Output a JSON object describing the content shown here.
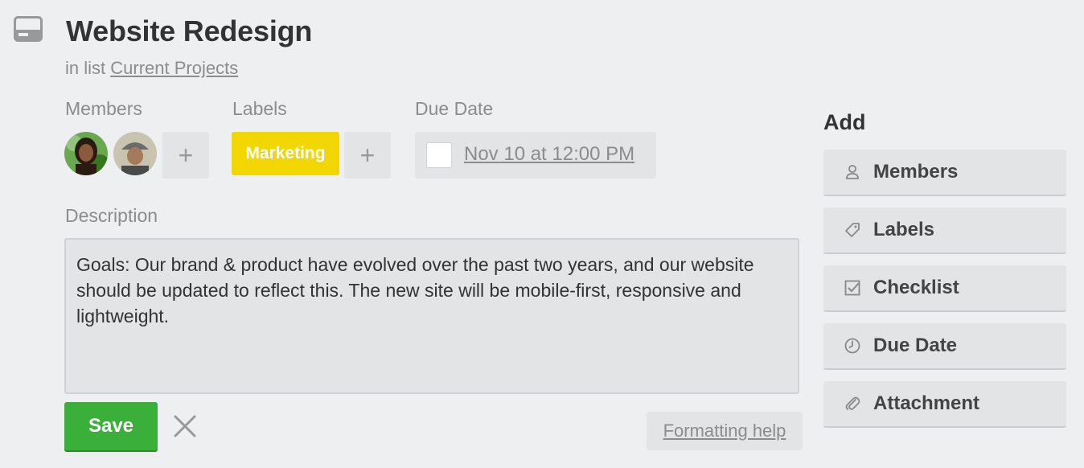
{
  "card": {
    "title": "Website Redesign",
    "list_prefix": "in list",
    "list_name": "Current Projects"
  },
  "members": {
    "heading": "Members",
    "add_symbol": "+"
  },
  "labels": {
    "heading": "Labels",
    "items": [
      {
        "text": "Marketing",
        "color": "#f2d600"
      }
    ],
    "add_symbol": "+"
  },
  "due": {
    "heading": "Due Date",
    "value": "Nov 10 at 12:00 PM"
  },
  "description": {
    "heading": "Description",
    "text": "Goals: Our brand & product have evolved over the past two years, and our website should be updated to reflect this. The new site will be mobile-first, responsive and lightweight.",
    "save_label": "Save",
    "formatting_help": "Formatting help"
  },
  "sidebar": {
    "heading": "Add",
    "buttons": [
      {
        "label": "Members",
        "icon": "person-icon"
      },
      {
        "label": "Labels",
        "icon": "tag-icon"
      },
      {
        "label": "Checklist",
        "icon": "checkbox-icon"
      },
      {
        "label": "Due Date",
        "icon": "clock-icon"
      },
      {
        "label": "Attachment",
        "icon": "paperclip-icon"
      }
    ]
  },
  "colors": {
    "save_green": "#3aaf3a",
    "label_yellow": "#f2d600",
    "background": "#edeff0"
  }
}
